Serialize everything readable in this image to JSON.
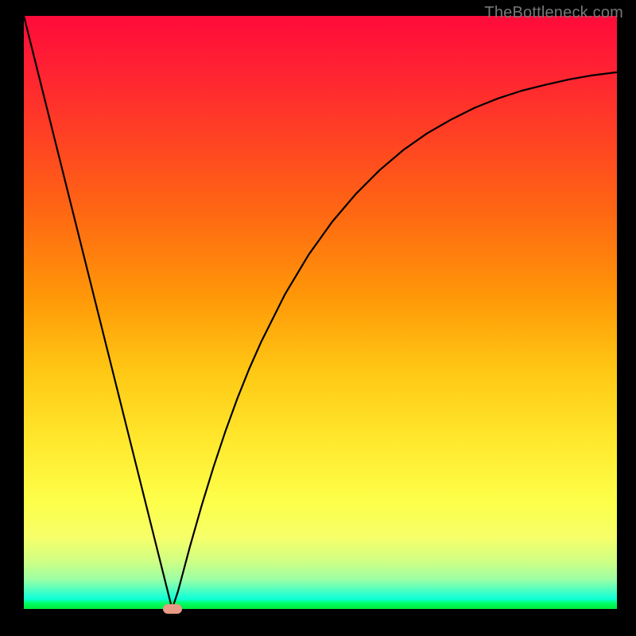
{
  "watermark": "TheBottleneck.com",
  "colors": {
    "curve_stroke": "#000000",
    "marker_fill": "#e79b86",
    "frame_bg": "#000000"
  },
  "chart_data": {
    "type": "line",
    "title": "",
    "xlabel": "",
    "ylabel": "",
    "xlim": [
      0,
      100
    ],
    "ylim": [
      0,
      100
    ],
    "grid": false,
    "legend": false,
    "series": [
      {
        "name": "bottleneck-curve",
        "x": [
          0,
          2,
          4,
          6,
          8,
          10,
          12,
          14,
          16,
          18,
          20,
          22,
          24,
          25,
          26,
          28,
          30,
          32,
          34,
          36,
          38,
          40,
          44,
          48,
          52,
          56,
          60,
          64,
          68,
          72,
          76,
          80,
          84,
          88,
          92,
          96,
          100
        ],
        "y": [
          100,
          92.0,
          84.0,
          76.0,
          68.0,
          60.0,
          52.0,
          44.0,
          36.0,
          28.0,
          20.0,
          12.0,
          4.0,
          0.0,
          3.0,
          10.5,
          17.5,
          24.0,
          30.0,
          35.5,
          40.5,
          45.0,
          53.0,
          59.7,
          65.3,
          70.0,
          74.0,
          77.4,
          80.2,
          82.5,
          84.5,
          86.1,
          87.4,
          88.4,
          89.3,
          90.0,
          90.5
        ]
      }
    ],
    "marker": {
      "x": 25,
      "y": 0
    }
  }
}
